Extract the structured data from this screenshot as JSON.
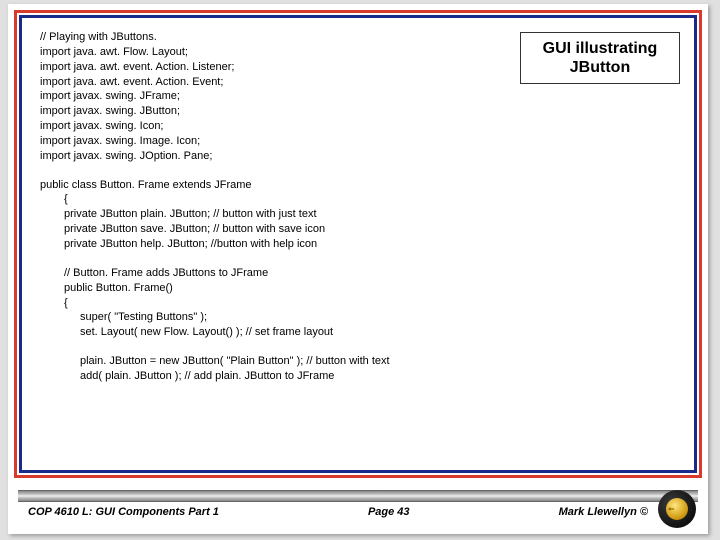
{
  "title": {
    "line1": "GUI illustrating",
    "line2": "JButton"
  },
  "code": {
    "imports": [
      "// Playing with JButtons.",
      "import java. awt. Flow. Layout;",
      "import java. awt. event. Action. Listener;",
      "import java. awt. event. Action. Event;",
      "import javax. swing. JFrame;",
      "import javax. swing. JButton;",
      "import javax. swing. Icon;",
      "import javax. swing. Image. Icon;",
      "import javax. swing. JOption. Pane;"
    ],
    "classDecl": "public class Button. Frame extends JFrame",
    "brace": "{",
    "fields": [
      "private JButton plain. JButton; // button with just text",
      "private JButton save. JButton; // button with save icon",
      "private JButton help. JButton; //button with help icon"
    ],
    "ctorComment": "// Button. Frame adds JButtons to JFrame",
    "ctorDecl": "public Button. Frame()",
    "ctorBrace": "{",
    "ctorBody1": "super( \"Testing Buttons\" );",
    "ctorBody2": "set. Layout( new Flow. Layout() ); // set frame layout",
    "ctorBody3": "plain. JButton = new JButton( \"Plain Button\" ); // button with text",
    "ctorBody4": "add( plain. JButton ); // add plain. JButton to JFrame"
  },
  "footer": {
    "left": "COP 4610 L: GUI Components Part 1",
    "center": "Page 43",
    "right": "Mark Llewellyn ©"
  }
}
